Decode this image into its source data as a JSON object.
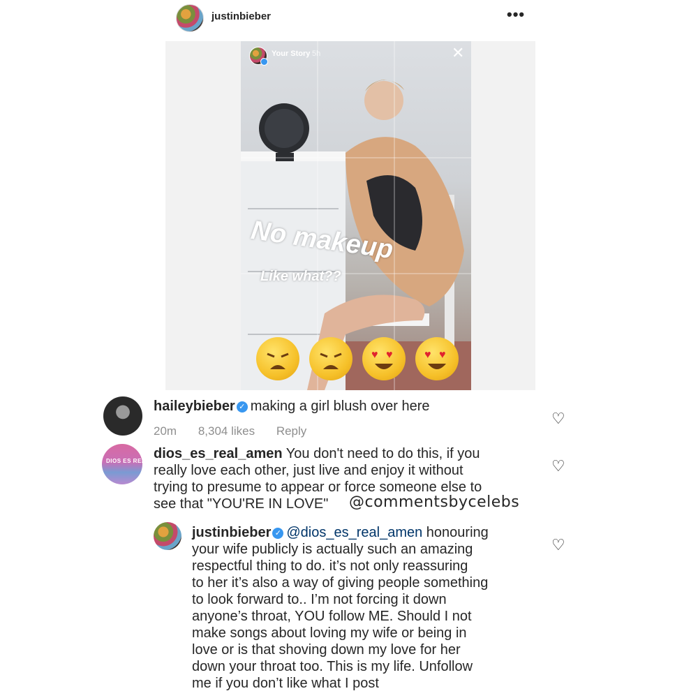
{
  "post": {
    "username": "justinbieber",
    "more_icon": "more-icon"
  },
  "story": {
    "label": "Your Story",
    "time": "5h",
    "close_glyph": "✕",
    "text_main": "No makeup",
    "text_sub": "Like what??",
    "emojis": [
      "weary-face",
      "weary-face",
      "heart-eyes",
      "heart-eyes"
    ]
  },
  "comments": [
    {
      "username": "haileybieber",
      "verified": true,
      "text": "making a girl blush over here",
      "time": "20m",
      "likes": "8,304 likes",
      "reply_label": "Reply"
    },
    {
      "username": "dios_es_real_amen",
      "avatar_text": "DIOS ES REAL",
      "lines": [
        "You don't need to do this, if you",
        "really love each other, just live and enjoy it without",
        "trying to presume to appear or force someone else to",
        "see that \"YOU'RE IN LOVE\""
      ]
    },
    {
      "username": "justinbieber",
      "verified": true,
      "mention": "@dios_es_real_amen",
      "lines": [
        "honouring",
        "your wife publicly is actually such an amazing",
        "respectful thing to do.  it’s not only reassuring",
        "to her it’s also a way of giving people something",
        "to look forward to.. I’m not forcing it down",
        "anyone’s throat, YOU follow ME. Should I not",
        "make songs about loving my wife or being in",
        "love or is that shoving down my love for her",
        "down your throat too. This is my life. Unfollow",
        "me if you don’t like what I post"
      ]
    }
  ],
  "watermark": "@commentsbycelebs",
  "icons": {
    "heart": "♡",
    "verified": "✓",
    "more": "•••"
  },
  "colors": {
    "text": "#262626",
    "muted": "#8e8e8e",
    "verified_blue": "#3897f0",
    "mention": "#003569"
  }
}
